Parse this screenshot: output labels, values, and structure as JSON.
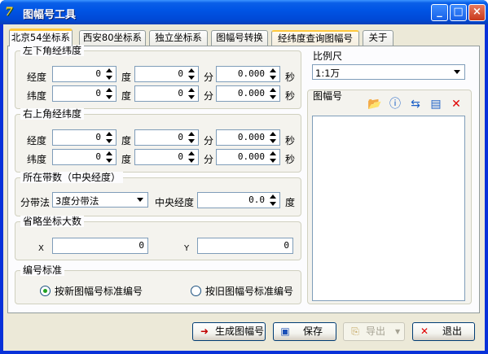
{
  "window": {
    "title": "图幅号工具",
    "minimize_glyph": "_",
    "maximize_glyph": "□",
    "close_glyph": "×"
  },
  "tabs": [
    {
      "label": "北京54坐标系",
      "active": true
    },
    {
      "label": "西安80坐标系"
    },
    {
      "label": "独立坐标系"
    },
    {
      "label": "图幅号转换"
    },
    {
      "label": "经纬度查询图幅号",
      "highlighted": true
    },
    {
      "label": "关于"
    }
  ],
  "lower_left": {
    "title": "左下角经纬度",
    "lon_label": "经度",
    "lat_label": "纬度",
    "deg_unit": "度",
    "min_unit": "分",
    "sec_unit": "秒",
    "lon": {
      "deg": "0",
      "min": "0",
      "sec": "0.000"
    },
    "lat": {
      "deg": "0",
      "min": "0",
      "sec": "0.000"
    }
  },
  "upper_right": {
    "title": "右上角经纬度",
    "lon_label": "经度",
    "lat_label": "纬度",
    "deg_unit": "度",
    "min_unit": "分",
    "sec_unit": "秒",
    "lon": {
      "deg": "0",
      "min": "0",
      "sec": "0.000"
    },
    "lat": {
      "deg": "0",
      "min": "0",
      "sec": "0.000"
    }
  },
  "zone": {
    "title": "所在带数（中央经度）",
    "method_label": "分带法",
    "method_value": "3度分带法",
    "meridian_label": "中央经度",
    "meridian_value": "0.0",
    "meridian_unit": "度"
  },
  "omit": {
    "title": "省略坐标大数",
    "x_label": "X",
    "x_value": "0",
    "y_label": "Y",
    "y_value": "0"
  },
  "numbering": {
    "title": "编号标准",
    "option_new": "按新图幅号标准编号",
    "option_old": "按旧图幅号标准编号",
    "selected": "new"
  },
  "scale": {
    "title": "比例尺",
    "value": "1:1万"
  },
  "sheet": {
    "title": "图幅号",
    "icons": [
      "open-folder-icon",
      "info-icon",
      "import-icon",
      "save-icon",
      "delete-icon"
    ]
  },
  "buttons": {
    "generate": "生成图幅号",
    "save": "保存",
    "export": "导出",
    "exit": "退出"
  },
  "colors": {
    "titlebar": "#0055e5",
    "tab_highlight": "#ffc83c",
    "radio_dot": "#21a121",
    "delete_icon": "#e00000"
  }
}
